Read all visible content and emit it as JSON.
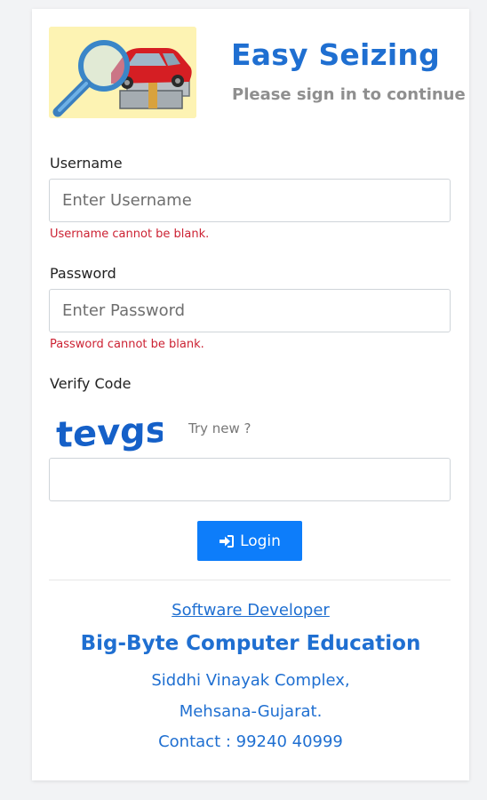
{
  "header": {
    "title": "Easy Seizing",
    "subtitle": "Please sign in to continue"
  },
  "form": {
    "username": {
      "label": "Username",
      "placeholder": "Enter Username",
      "value": "",
      "error": "Username cannot be blank."
    },
    "password": {
      "label": "Password",
      "placeholder": "Enter Password",
      "value": "",
      "error": "Password cannot be blank."
    },
    "verify": {
      "label": "Verify Code",
      "captcha_text": "tevgs",
      "try_new_label": "Try new ?",
      "value": ""
    },
    "login_label": "Login",
    "login_icon": "sign-in-icon"
  },
  "footer": {
    "developer_link": "Software Developer",
    "company": "Big-Byte Computer Education",
    "address_line1": "Siddhi Vinayak Complex,",
    "address_line2": "Mehsana-Gujarat.",
    "contact": "Contact : 99240 40999"
  },
  "colors": {
    "brand": "#1f6fd1",
    "button": "#0d7dfa",
    "error": "#cc2233",
    "captcha": "#1560c8"
  }
}
